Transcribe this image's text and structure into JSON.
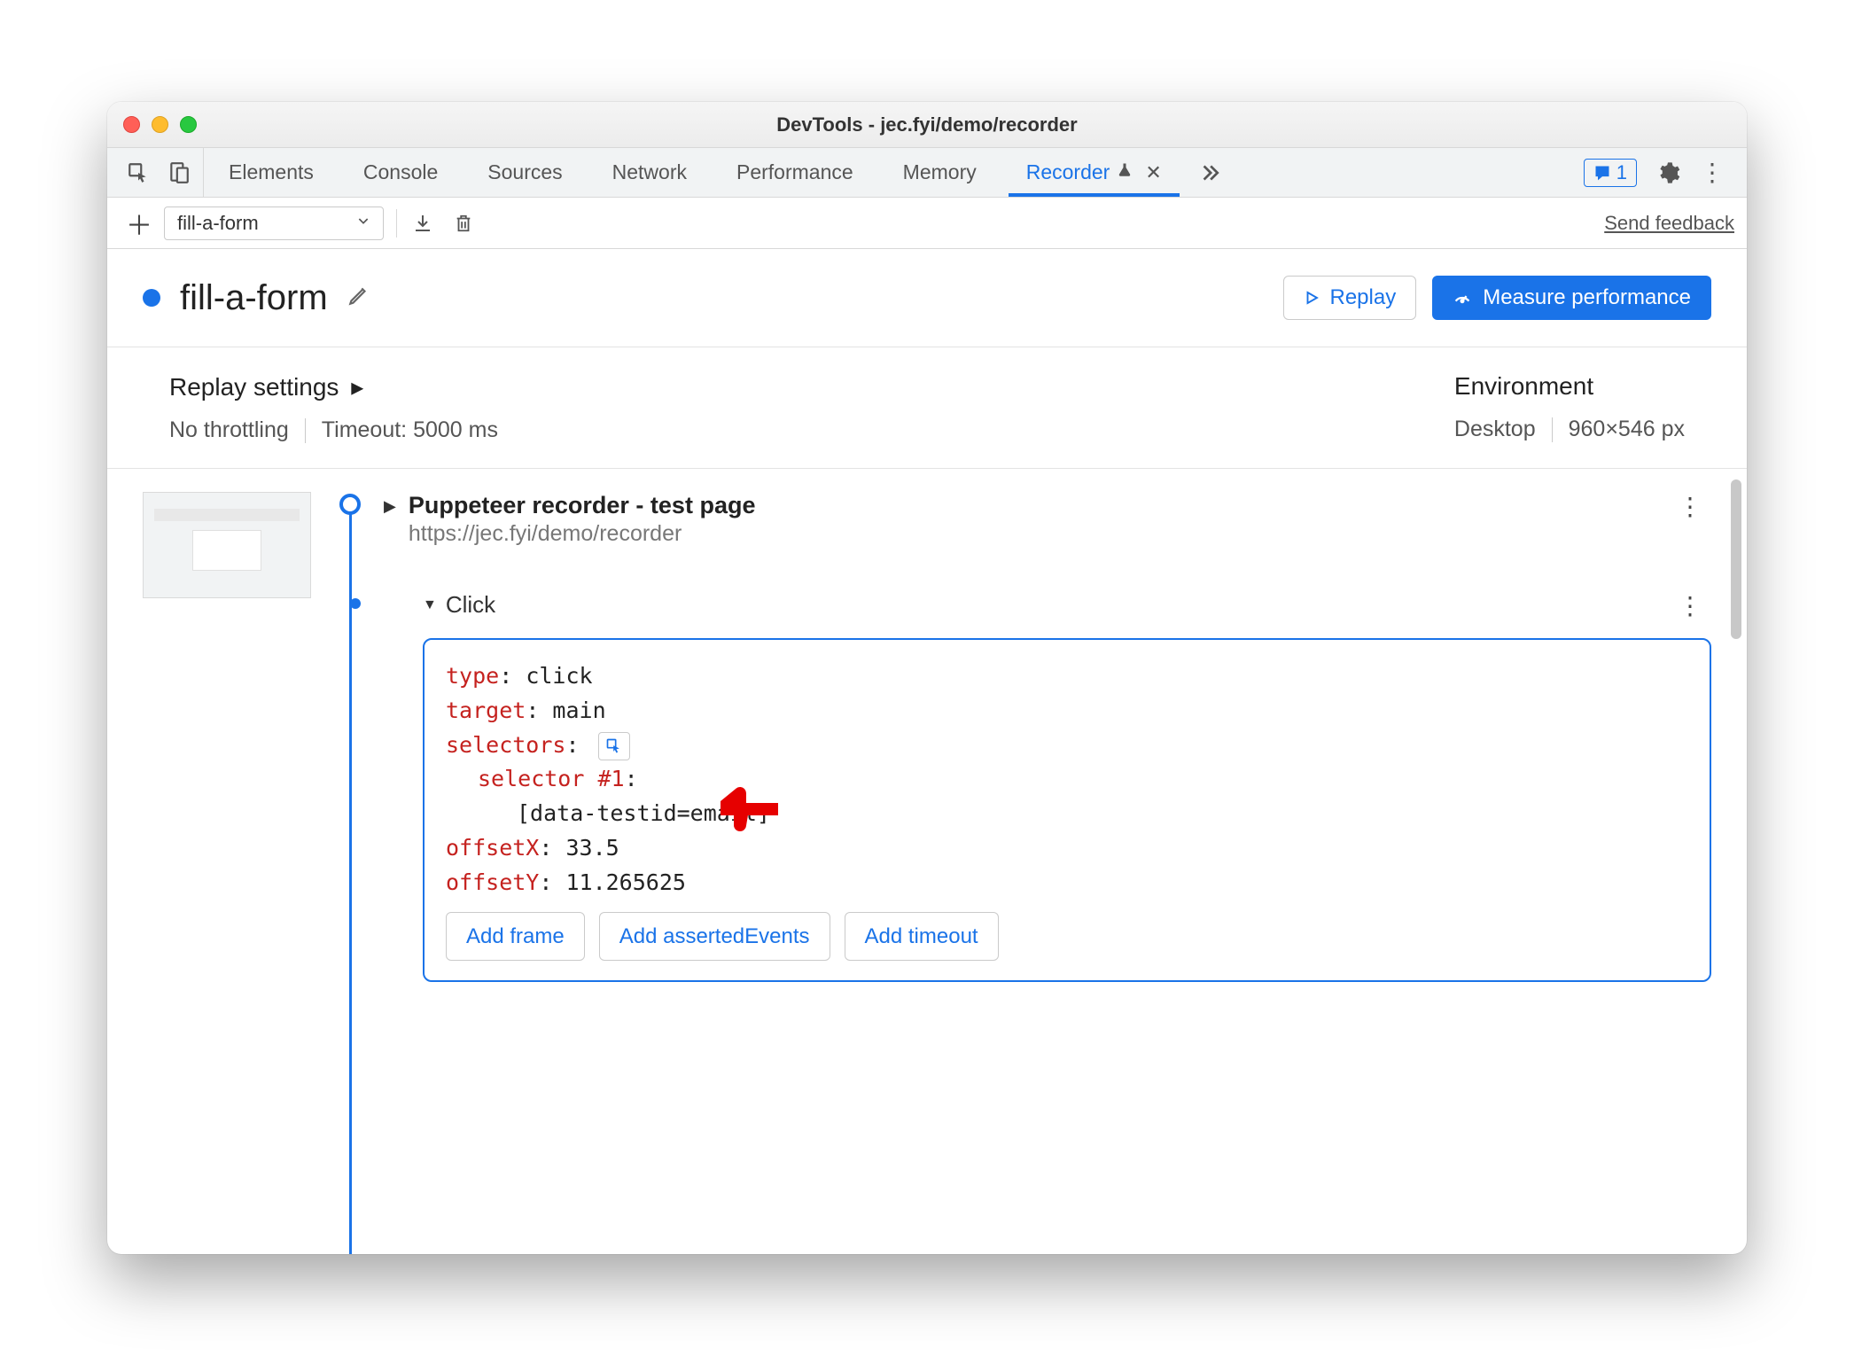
{
  "window": {
    "title": "DevTools - jec.fyi/demo/recorder"
  },
  "tabs": {
    "items": [
      "Elements",
      "Console",
      "Sources",
      "Network",
      "Performance",
      "Memory"
    ],
    "active": "Recorder",
    "feedback_count": "1"
  },
  "toolbar": {
    "flow_name": "fill-a-form",
    "send_feedback": "Send feedback"
  },
  "header": {
    "title": "fill-a-form",
    "replay_label": "Replay",
    "measure_label": "Measure performance"
  },
  "settings": {
    "replay_heading": "Replay settings",
    "throttling": "No throttling",
    "timeout": "Timeout: 5000 ms",
    "env_heading": "Environment",
    "device": "Desktop",
    "dims": "960×546 px"
  },
  "steps": {
    "page": {
      "title": "Puppeteer recorder - test page",
      "url": "https://jec.fyi/demo/recorder"
    },
    "click": {
      "label": "Click",
      "props": {
        "type_key": "type",
        "type_val": "click",
        "target_key": "target",
        "target_val": "main",
        "selectors_key": "selectors",
        "selector_idx_label": "selector #1",
        "selector_val": "[data-testid=email]",
        "offsetX_key": "offsetX",
        "offsetX_val": "33.5",
        "offsetY_key": "offsetY",
        "offsetY_val": "11.265625"
      },
      "buttons": {
        "add_frame": "Add frame",
        "add_asserted": "Add assertedEvents",
        "add_timeout": "Add timeout"
      }
    }
  }
}
